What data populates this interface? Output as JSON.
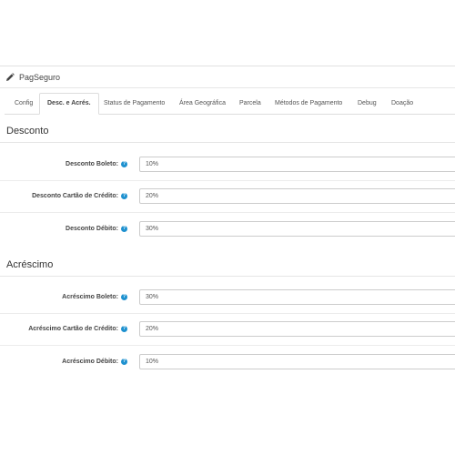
{
  "panel": {
    "title": "PagSeguro",
    "icon": "pencil-icon"
  },
  "tabs": [
    {
      "label": "Config"
    },
    {
      "label": "Desc. e Acrés."
    },
    {
      "label": "Status de Pagamento"
    },
    {
      "label": "Área Geográfica"
    },
    {
      "label": "Parcela"
    },
    {
      "label": "Métodos de Pagamento"
    },
    {
      "label": "Debug"
    },
    {
      "label": "Doação"
    }
  ],
  "desconto": {
    "title": "Desconto",
    "rows": [
      {
        "label": "Desconto Boleto:",
        "value": "10%"
      },
      {
        "label": "Desconto Cartão de Crédito:",
        "value": "20%"
      },
      {
        "label": "Desconto Débito:",
        "value": "30%"
      }
    ]
  },
  "acrescimo": {
    "title": "Acréscimo",
    "rows": [
      {
        "label": "Acréscimo Boleto:",
        "value": "30%"
      },
      {
        "label": "Acréscimo Cartão de Crédito:",
        "value": "20%"
      },
      {
        "label": "Acréscimo Débito:",
        "value": "10%"
      }
    ]
  },
  "help_glyph": "?",
  "colors": {
    "accent": "#1e91cf"
  }
}
